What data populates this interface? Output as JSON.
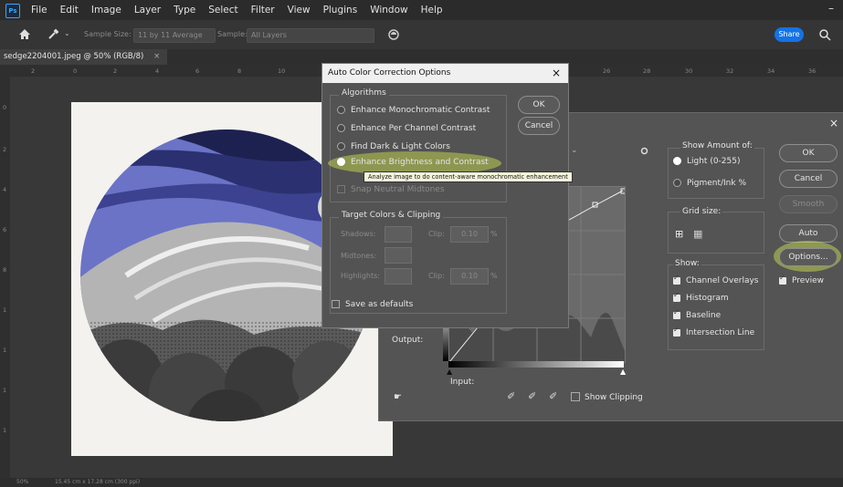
{
  "app": {
    "icon_label": "Ps",
    "menus": [
      "File",
      "Edit",
      "Image",
      "Layer",
      "Type",
      "Select",
      "Filter",
      "View",
      "Plugins",
      "Window",
      "Help"
    ],
    "minimize": "–"
  },
  "options_bar": {
    "sample_size_label": "Sample Size:",
    "sample_size_value": "11 by 11 Average",
    "sample_label": "Sample:",
    "sample_value": "All Layers",
    "share_label": "Share"
  },
  "document": {
    "tab_title": "sedge2204001.jpeg @ 50% (RGB/8)",
    "tab_close": "×",
    "status_zoom": "50%",
    "status_size": "15.45 cm x 17.28 cm (300 ppi)"
  },
  "rulers": {
    "top": [
      "2",
      "0",
      "2",
      "4",
      "6",
      "8",
      "10",
      "26",
      "28",
      "30",
      "32",
      "34",
      "36"
    ],
    "left": [
      "0",
      "2",
      "4",
      "6",
      "8",
      "1",
      "1",
      "1",
      "1"
    ]
  },
  "curves_dialog": {
    "close": "×",
    "show_amount_label": "Show Amount of:",
    "light_label": "Light (0-255)",
    "pigment_label": "Pigment/Ink %",
    "grid_size_label": "Grid size:",
    "show_label": "Show:",
    "channel_overlays": "Channel Overlays",
    "histogram": "Histogram",
    "baseline": "Baseline",
    "intersection_line": "Intersection Line",
    "ok": "OK",
    "cancel": "Cancel",
    "smooth": "Smooth",
    "auto": "Auto",
    "options": "Options...",
    "preview": "Preview",
    "output_label": "Output:",
    "input_label": "Input:",
    "show_clipping": "Show Clipping"
  },
  "acc_dialog": {
    "title": "Auto Color Correction Options",
    "close": "×",
    "algorithms_label": "Algorithms",
    "options": [
      {
        "label": "Enhance Monochromatic Contrast",
        "selected": false
      },
      {
        "label": "Enhance Per Channel Contrast",
        "selected": false
      },
      {
        "label": "Find Dark & Light Colors",
        "selected": false
      },
      {
        "label": "Enhance Brightness and Contrast",
        "selected": true
      }
    ],
    "snap_label": "Snap Neutral Midtones",
    "target_label": "Target Colors & Clipping",
    "shadows_label": "Shadows:",
    "midtones_label": "Midtones:",
    "highlights_label": "Highlights:",
    "clip_label": "Clip:",
    "shadows_clip": "0.10",
    "highlights_clip": "0.10",
    "percent": "%",
    "save_defaults": "Save as defaults",
    "ok": "OK",
    "cancel": "Cancel",
    "tooltip": "Analyze image to do content-aware monochromatic enhancement"
  },
  "colors": {
    "accent": "#1473e6",
    "highlight": "#d8eb50",
    "artwork_blue": "#6b73c6"
  }
}
